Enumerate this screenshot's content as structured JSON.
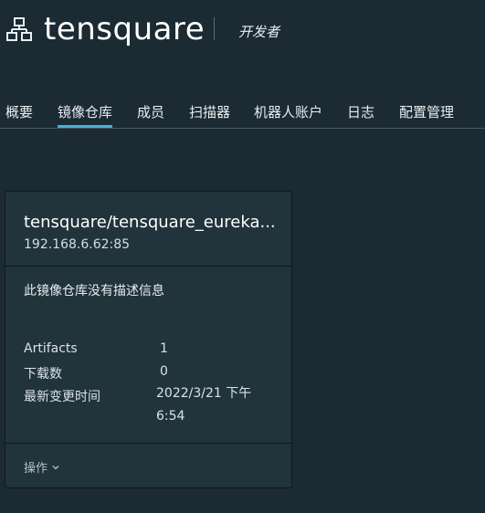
{
  "header": {
    "project_name": "tensquare",
    "role": "开发者",
    "icon": "project-icon"
  },
  "tabs": [
    {
      "label": "概要",
      "active": false
    },
    {
      "label": "镜像仓库",
      "active": true
    },
    {
      "label": "成员",
      "active": false
    },
    {
      "label": "扫描器",
      "active": false
    },
    {
      "label": "机器人账户",
      "active": false
    },
    {
      "label": "日志",
      "active": false
    },
    {
      "label": "配置管理",
      "active": false
    }
  ],
  "repository_card": {
    "title": "tensquare/tensquare_eureka...",
    "registry": "192.168.6.62:85",
    "description": "此镜像仓库没有描述信息",
    "stats": [
      {
        "label": "Artifacts",
        "value": "1"
      },
      {
        "label": "下载数",
        "value": "0"
      },
      {
        "label": "最新变更时间",
        "value": "2022/3/21 下午 6:54"
      }
    ],
    "actions_label": "操作",
    "actions_icon": "chevron-down-icon"
  },
  "colors": {
    "background": "#1b2a33",
    "card": "#21333b",
    "accent": "#49afd9"
  }
}
